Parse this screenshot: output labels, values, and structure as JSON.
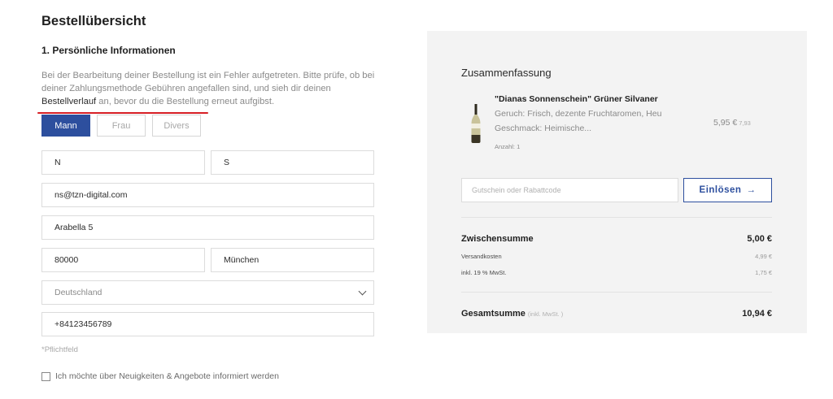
{
  "page": {
    "title": "Bestellübersicht"
  },
  "personal": {
    "title": "1. Persönliche Informationen",
    "error_part1": "Bei der Bearbeitung deiner Bestellung ist ein Fehler aufgetreten. Bitte prüfe, ob bei deiner Zahlungsmethode Gebühren angefallen sind, und sieh dir deinen ",
    "error_link": "Bestellverlauf",
    "error_part2": " an, bevor du die Bestellung erneut aufgibst.",
    "gender": {
      "options": [
        "Mann",
        "Frau",
        "Divers"
      ],
      "selected": "Mann"
    },
    "fields": {
      "first_name": "N",
      "last_name": "S",
      "email": "ns@tzn-digital.com",
      "street": "Arabella 5",
      "zip": "80000",
      "city": "München",
      "country": "Deutschland",
      "phone": "+84123456789"
    },
    "required_note": "*Pflichtfeld",
    "newsletter_label": "Ich möchte über Neuigkeiten & Angebote informiert werden"
  },
  "summary": {
    "title": "Zusammenfassung",
    "product": {
      "name": "\"Dianas Sonnenschein\" Grüner Silvaner",
      "desc_line1": "Geruch: Frisch, dezente Fruchtaromen, Heu",
      "desc_line2": "Geschmack: Heimische...",
      "quantity": "Anzahl: 1",
      "price": "5,95 €",
      "old_price": "7,93"
    },
    "coupon": {
      "placeholder": "Gutschein oder Rabattcode",
      "button_label": "Einlösen",
      "button_arrow": "→"
    },
    "subtotal_label": "Zwischensumme",
    "subtotal_value": "5,00 €",
    "shipping_label": "Versandkosten",
    "shipping_value": "4,99 €",
    "vat_label": "inkl. 19 % MwSt.",
    "vat_value": "1,75 €",
    "total_label": "Gesamtsumme",
    "total_note": "(inkl. MwSt. )",
    "total_value": "10,94 €"
  },
  "colors": {
    "accent": "#2d4f9e",
    "error_underline": "#d71f25",
    "panel_bg": "#f3f3f3"
  }
}
